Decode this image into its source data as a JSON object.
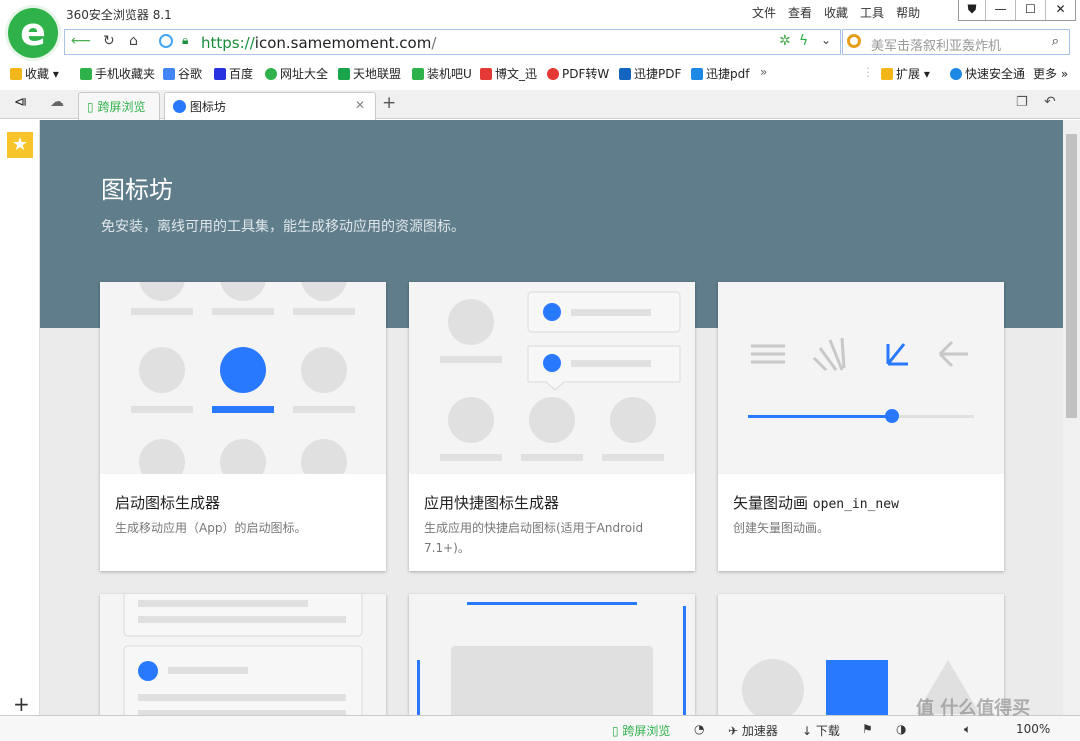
{
  "app": {
    "title": "360安全浏览器 8.1",
    "logo_letter": "e"
  },
  "menu": [
    "文件",
    "查看",
    "收藏",
    "工具",
    "帮助"
  ],
  "window_buttons": [
    "⛊",
    "—",
    "☐",
    "✕"
  ],
  "address": {
    "scheme": "https://",
    "host": "icon.samemoment.com",
    "path": "/"
  },
  "search": {
    "placeholder": "美军击落叙利亚轰炸机"
  },
  "bookmarks": [
    {
      "label": "收藏",
      "color": "#f2b619"
    },
    {
      "label": "手机收藏夹",
      "color": "#2fb24a"
    },
    {
      "label": "谷歌",
      "color": "#4285f4"
    },
    {
      "label": "百度",
      "color": "#2932e1"
    },
    {
      "label": "网址大全",
      "color": "#2fb24a"
    },
    {
      "label": "天地联盟",
      "color": "#1aa54a"
    },
    {
      "label": "装机吧U",
      "color": "#2fb24a"
    },
    {
      "label": "博文_迅",
      "color": "#e53935"
    },
    {
      "label": "PDF转W",
      "color": "#e53935"
    },
    {
      "label": "迅捷PDF",
      "color": "#1565c0"
    },
    {
      "label": "迅捷pdf",
      "color": "#1e88e5"
    }
  ],
  "bookmarks_right": [
    {
      "label": "扩展",
      "color": "#f2b619"
    },
    {
      "label": "快速安全通",
      "color": "#1e88e5"
    },
    {
      "label": "更多"
    }
  ],
  "tabs": [
    {
      "label": "跨屏浏览"
    },
    {
      "label": "图标坊"
    }
  ],
  "page": {
    "title": "图标坊",
    "subtitle": "免安装，离线可用的工具集，能生成移动应用的资源图标。",
    "accent": "#2979ff",
    "hero_color": "#607d8b",
    "cards": [
      {
        "title": "启动图标生成器",
        "desc": "生成移动应用（App）的启动图标。"
      },
      {
        "title": "应用快捷图标生成器",
        "desc": "生成应用的快捷启动图标(适用于Android 7.1+)。"
      },
      {
        "title": "矢量图动画",
        "title_icon": "open_in_new",
        "desc": "创建矢量图动画。"
      }
    ]
  },
  "status": {
    "cross_screen": "跨屏浏览",
    "accelerator": "加速器",
    "download": "下载",
    "zoom": "100%",
    "watermark": "值 什么值得买"
  }
}
